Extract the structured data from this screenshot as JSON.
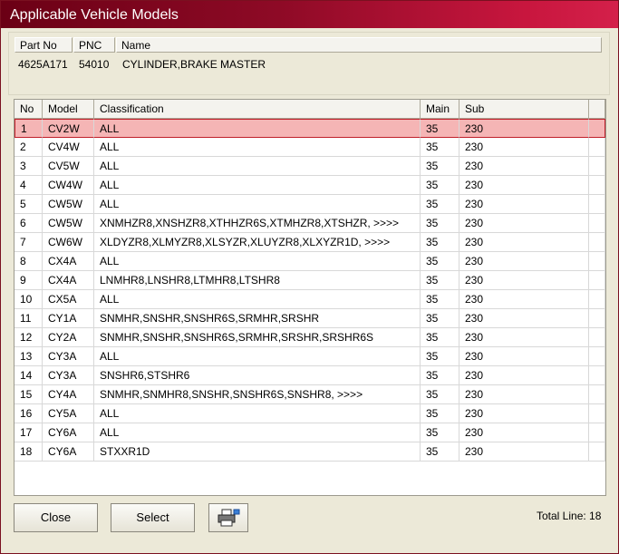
{
  "window": {
    "title": "Applicable Vehicle Models"
  },
  "part": {
    "headers": {
      "part_no": "Part No",
      "pnc": "PNC",
      "name": "Name"
    },
    "values": {
      "part_no": "4625A171",
      "pnc": "54010",
      "name": "CYLINDER,BRAKE MASTER"
    }
  },
  "grid": {
    "columns": [
      "No",
      "Model",
      "Classification",
      "Main",
      "Sub"
    ],
    "selected_index": 0,
    "rows": [
      {
        "no": "1",
        "model": "CV2W",
        "classification": "ALL",
        "main": "35",
        "sub": "230"
      },
      {
        "no": "2",
        "model": "CV4W",
        "classification": "ALL",
        "main": "35",
        "sub": "230"
      },
      {
        "no": "3",
        "model": "CV5W",
        "classification": "ALL",
        "main": "35",
        "sub": "230"
      },
      {
        "no": "4",
        "model": "CW4W",
        "classification": "ALL",
        "main": "35",
        "sub": "230"
      },
      {
        "no": "5",
        "model": "CW5W",
        "classification": "ALL",
        "main": "35",
        "sub": "230"
      },
      {
        "no": "6",
        "model": "CW5W",
        "classification": "XNMHZR8,XNSHZR8,XTHHZR6S,XTMHZR8,XTSHZR,  >>>>",
        "main": "35",
        "sub": "230"
      },
      {
        "no": "7",
        "model": "CW6W",
        "classification": "XLDYZR8,XLMYZR8,XLSYZR,XLUYZR8,XLXYZR1D,  >>>>",
        "main": "35",
        "sub": "230"
      },
      {
        "no": "8",
        "model": "CX4A",
        "classification": "ALL",
        "main": "35",
        "sub": "230"
      },
      {
        "no": "9",
        "model": "CX4A",
        "classification": "LNMHR8,LNSHR8,LTMHR8,LTSHR8",
        "main": "35",
        "sub": "230"
      },
      {
        "no": "10",
        "model": "CX5A",
        "classification": "ALL",
        "main": "35",
        "sub": "230"
      },
      {
        "no": "11",
        "model": "CY1A",
        "classification": "SNMHR,SNSHR,SNSHR6S,SRMHR,SRSHR",
        "main": "35",
        "sub": "230"
      },
      {
        "no": "12",
        "model": "CY2A",
        "classification": "SNMHR,SNSHR,SNSHR6S,SRMHR,SRSHR,SRSHR6S",
        "main": "35",
        "sub": "230"
      },
      {
        "no": "13",
        "model": "CY3A",
        "classification": "ALL",
        "main": "35",
        "sub": "230"
      },
      {
        "no": "14",
        "model": "CY3A",
        "classification": "SNSHR6,STSHR6",
        "main": "35",
        "sub": "230"
      },
      {
        "no": "15",
        "model": "CY4A",
        "classification": "SNMHR,SNMHR8,SNSHR,SNSHR6S,SNSHR8,  >>>>",
        "main": "35",
        "sub": "230"
      },
      {
        "no": "16",
        "model": "CY5A",
        "classification": "ALL",
        "main": "35",
        "sub": "230"
      },
      {
        "no": "17",
        "model": "CY6A",
        "classification": "ALL",
        "main": "35",
        "sub": "230"
      },
      {
        "no": "18",
        "model": "CY6A",
        "classification": "STXXR1D",
        "main": "35",
        "sub": "230"
      }
    ]
  },
  "buttons": {
    "close": "Close",
    "select": "Select",
    "print_icon": "printer-icon"
  },
  "footer": {
    "total_line": "Total Line: 18"
  },
  "colors": {
    "title_start": "#6b0015",
    "title_end": "#d4204a",
    "selected_row": "#f5b5b5",
    "selected_border": "#c0202a"
  }
}
